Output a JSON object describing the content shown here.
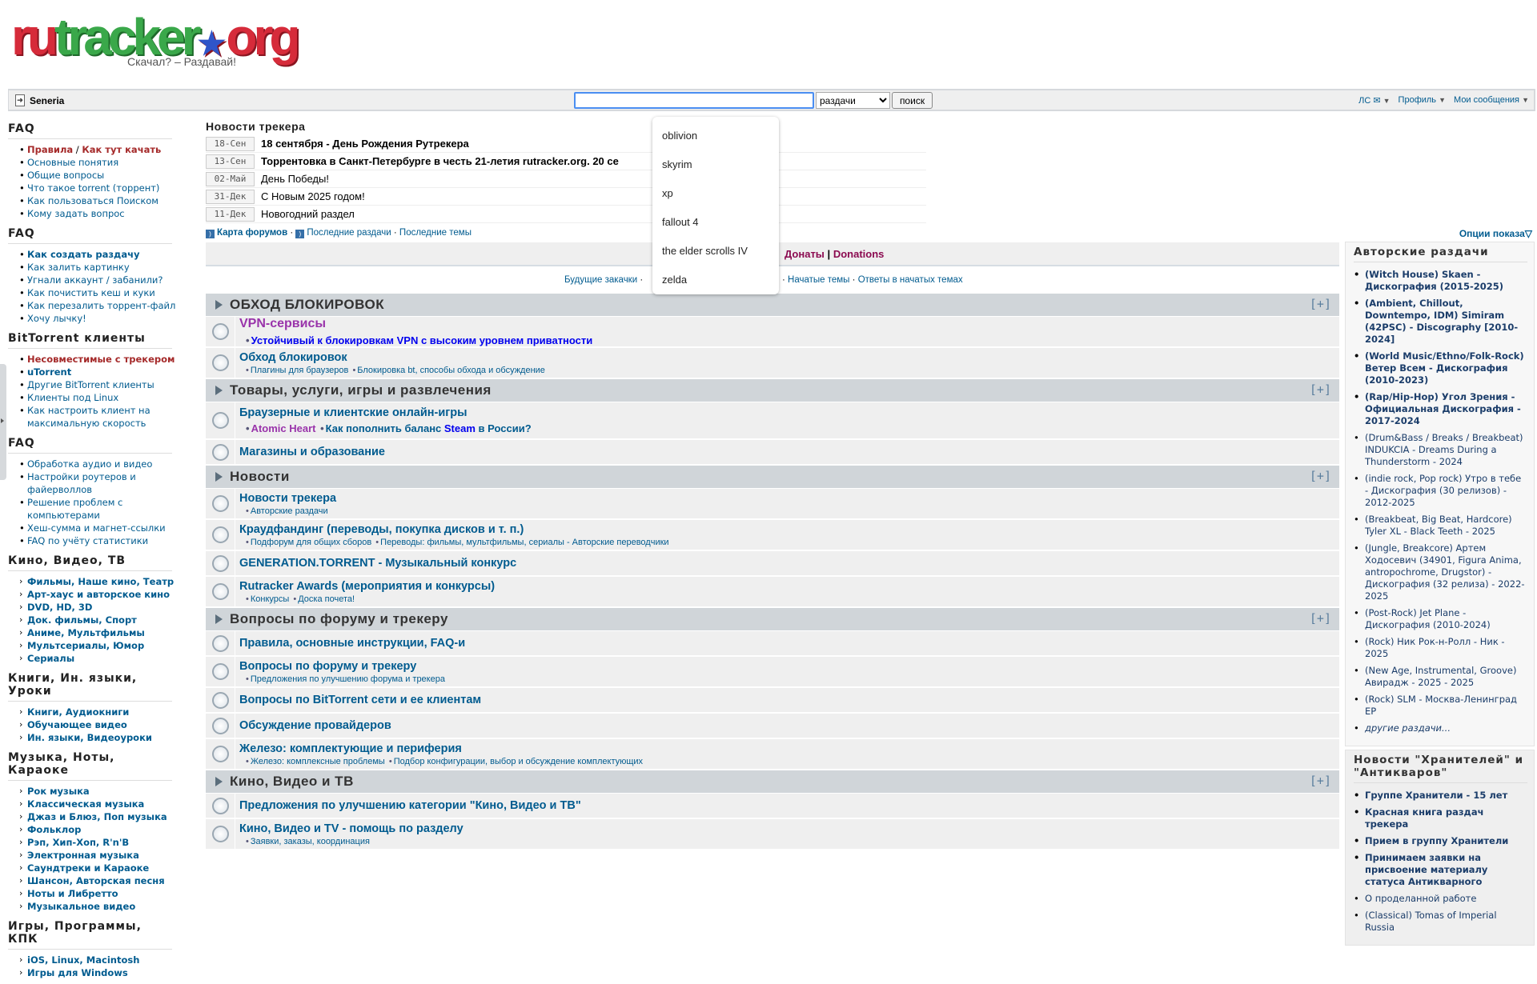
{
  "logo": {
    "text": "rutracker.org",
    "slogan": "Скачал? – Раздавай!"
  },
  "topbar": {
    "username": "Seneria",
    "search_value": "",
    "search_select": "раздачи",
    "search_button": "поиск",
    "menu": [
      {
        "label": "ЛС ✉"
      },
      {
        "label": "Профиль"
      },
      {
        "label": "Мои сообщения"
      }
    ]
  },
  "autocomplete": [
    "oblivion",
    "skyrim",
    "xp",
    "fallout 4",
    "the elder scrolls IV",
    "zelda"
  ],
  "left_sidebar": [
    {
      "title": "FAQ",
      "style": "bullet",
      "items": [
        {
          "label": "Правила",
          "red": true
        },
        {
          "label": "Основные понятия"
        },
        {
          "label": "Общие вопросы"
        },
        {
          "label": "Что такое torrent (торрент)"
        },
        {
          "label": "Как пользоваться Поиском"
        },
        {
          "label": "Кому задать вопрос"
        }
      ],
      "first_extra": "Как тут качать"
    },
    {
      "title": "FAQ",
      "style": "bullet",
      "items": [
        {
          "label": "Как создать раздачу",
          "bold": true
        },
        {
          "label": "Как залить картинку"
        },
        {
          "label": "Угнали аккаунт / забанили?"
        },
        {
          "label": "Как почистить кеш и куки"
        },
        {
          "label": "Как перезалить торрент-файл"
        },
        {
          "label": "Хочу лычку!"
        }
      ]
    },
    {
      "title": "BitTorrent клиенты",
      "style": "bullet",
      "items": [
        {
          "label": "Несовместимые с трекером",
          "red": true,
          "bold": true
        },
        {
          "label": "uTorrent",
          "bold": true
        },
        {
          "label": "Другие BitTorrent клиенты"
        },
        {
          "label": "Клиенты под Linux"
        },
        {
          "label": "Как настроить клиент на максимальную скорость"
        }
      ]
    },
    {
      "title": "FAQ",
      "style": "bullet",
      "items": [
        {
          "label": "Обработка аудио и видео"
        },
        {
          "label": "Настройки роутеров и файерволлов"
        },
        {
          "label": "Решение проблем с компьютерами"
        },
        {
          "label": "Хеш-сумма и магнет-ссылки"
        },
        {
          "label": "FAQ по учёту статистики"
        }
      ]
    },
    {
      "title": "Кино, Видео, ТВ",
      "style": "arrow",
      "items": [
        {
          "label": "Фильмы, Наше кино, Театр"
        },
        {
          "label": "Арт-хаус и авторское кино"
        },
        {
          "label": "DVD, HD, 3D"
        },
        {
          "label": "Док. фильмы, Спорт"
        },
        {
          "label": "Аниме, Мультфильмы"
        },
        {
          "label": "Мультсериалы, Юмор"
        },
        {
          "label": "Сериалы"
        }
      ]
    },
    {
      "title": "Книги, Ин. языки, Уроки",
      "style": "arrow",
      "items": [
        {
          "label": "Книги, Аудиокниги"
        },
        {
          "label": "Обучающее видео"
        },
        {
          "label": "Ин. языки, Видеоуроки"
        }
      ]
    },
    {
      "title": "Музыка, Ноты, Караоке",
      "style": "arrow",
      "items": [
        {
          "label": "Рок музыка"
        },
        {
          "label": "Классическая музыка"
        },
        {
          "label": "Джаз и Блюз, Поп музыка"
        },
        {
          "label": "Фольклор"
        },
        {
          "label": "Рэп, Хип-Хоп, R'n'B"
        },
        {
          "label": "Электронная музыка"
        },
        {
          "label": "Саундтреки и Караоке"
        },
        {
          "label": "Шансон, Авторская песня"
        },
        {
          "label": "Ноты и Либретто"
        },
        {
          "label": "Музыкальное видео"
        }
      ]
    },
    {
      "title": "Игры, Программы, КПК",
      "style": "arrow",
      "items": [
        {
          "label": "iOS, Linux, Macintosh"
        },
        {
          "label": "Игры для Windows"
        }
      ]
    }
  ],
  "news": {
    "title": "Новости трекера",
    "items": [
      {
        "date": "18-Сен",
        "text": "18 сентября - День Рождения Рутрекера",
        "bold": true
      },
      {
        "date": "13-Сен",
        "text": "Торрентовка в Санкт-Петербурге в честь 21-летия rutracker.org. 20 се",
        "bold": true
      },
      {
        "date": "02-Май",
        "text": "День Победы!",
        "bold": false
      },
      {
        "date": "31-Дек",
        "text": "С Новым 2025 годом!",
        "bold": false
      },
      {
        "date": "11-Дек",
        "text": "Новогодний раздел",
        "bold": false
      }
    ],
    "links": [
      "Карта форумов",
      "Последние раздачи",
      "Последние темы"
    ]
  },
  "display_options": "Опции показа",
  "donate": {
    "a": "Донаты",
    "sep": "|",
    "b": "Donations"
  },
  "main_links": [
    "Будущие закачки",
    "Начатые темы",
    "Ответы в начатых темах"
  ],
  "categories": [
    {
      "title": "ОБХОД БЛОКИРОВОК",
      "forums": [
        {
          "title": "VPN-сервисы",
          "vpn": true,
          "subs": [
            {
              "text": "Устойчивый к блокировкам VPN с высоким уровнем приватности",
              "color": "#0000ee"
            }
          ],
          "big": true
        },
        {
          "title": "Обход блокировок",
          "subs": [
            {
              "text": "Плагины для браузеров"
            },
            {
              "text": "Блокировка bt, способы обхода и обсуждение"
            }
          ]
        }
      ]
    },
    {
      "title": "Товары, услуги, игры и развлечения",
      "forums": [
        {
          "title": "Браузерные и клиентские онлайн-игры",
          "big": true,
          "tall": true,
          "subs": [
            {
              "text": "Atomic Heart",
              "color": "#9933aa"
            },
            {
              "text": "Как пополнить баланс ",
              "tail": "Steam",
              "tail_color": "#0000ee",
              "tail2": " в России?"
            }
          ]
        },
        {
          "title": "Магазины и образование",
          "subs": []
        }
      ]
    },
    {
      "title": "Новости",
      "forums": [
        {
          "title": "Новости трекера",
          "subs": [
            {
              "text": "Авторские раздачи"
            }
          ]
        },
        {
          "title": "Краудфандинг (переводы, покупка дисков и т. п.)",
          "subs": [
            {
              "text": "Подфорум для общих сборов"
            },
            {
              "text": "Переводы: фильмы, мультфильмы, сериалы - Авторские переводчики"
            }
          ]
        },
        {
          "title": "GENERATION.TORRENT - Музыкальный конкурс",
          "subs": []
        },
        {
          "title": "Rutracker Awards (мероприятия и конкурсы)",
          "subs": [
            {
              "text": "Конкурсы"
            },
            {
              "text": "Доска почета!"
            }
          ]
        }
      ]
    },
    {
      "title": "Вопросы по форуму и трекеру",
      "forums": [
        {
          "title": "Правила, основные инструкции, FAQ-и",
          "subs": []
        },
        {
          "title": "Вопросы по форуму и трекеру",
          "subs": [
            {
              "text": "Предложения по улучшению форума и трекера"
            }
          ]
        },
        {
          "title": "Вопросы по BitTorrent сети и ее клиентам",
          "subs": []
        },
        {
          "title": "Обсуждение провайдеров",
          "subs": []
        },
        {
          "title": "Железо: комплектующие и периферия",
          "subs": [
            {
              "text": "Железо: комплексные проблемы"
            },
            {
              "text": "Подбор конфигурации, выбор и обсуждение комплектующих"
            }
          ]
        }
      ]
    },
    {
      "title": "Кино, Видео и ТВ",
      "forums": [
        {
          "title": "Предложения по улучшению категории \"Кино, Видео и ТВ\"",
          "subs": []
        },
        {
          "title": "Кино, Видео и TV - помощь по разделу",
          "subs": [
            {
              "text": "Заявки, заказы, координация"
            }
          ]
        }
      ]
    }
  ],
  "collapse_label": "[+]",
  "right_sidebar": [
    {
      "title": "Авторские раздачи",
      "items": [
        {
          "label": "(Witch House) Skaen - Дискография (2015-2025)",
          "bold": true
        },
        {
          "label": "(Ambient, Chillout, Downtempo, IDM) Simiram (42PSC) - Discography [2010-2024]",
          "bold": true
        },
        {
          "label": "(World Music/Ethno/Folk-Rock) Ветер Всем - Дискография (2010-2023)",
          "bold": true
        },
        {
          "label": "(Rap/Hip-Hop) Угол Зрения - Официальная Дискография - 2017-2024",
          "bold": true
        },
        {
          "label": "(Drum&Bass / Breaks / Breakbeat) INDUKCIA - Dreams During a Thunderstorm - 2024"
        },
        {
          "label": "(indie rock, Pop rock) Утро в тебе - Дискография (30 релизов) - 2012-2025"
        },
        {
          "label": "(Breakbeat, Big Beat, Hardcore) Tyler XL - Black Teeth - 2025"
        },
        {
          "label": "(Jungle, Breakcore) Артем Ходосевич (34901, Figura Anima, antropochrome, Drugstor) - Дискография (32 релиза) - 2022-2025"
        },
        {
          "label": "(Post-Rock) Jet Plane - Дискография (2010-2024)"
        },
        {
          "label": "(Rock) Ник Рок-н-Ролл - Ник - 2025"
        },
        {
          "label": "(New Age, Instrumental, Groove) Авирадж - 2025 - 2025"
        },
        {
          "label": "(Rock) SLM - Москва-Ленинград EP"
        },
        {
          "label": "другие раздачи...",
          "italic": true
        }
      ]
    },
    {
      "title": "Новости \"Хранителей\" и \"Антикваров\"",
      "items": [
        {
          "label": "Группе Хранители - 15 лет",
          "bold": true
        },
        {
          "label": "Красная книга раздач трекера",
          "bold": true
        },
        {
          "label": "Прием в группу Хранители",
          "bold": true
        },
        {
          "label": "Принимаем заявки на присвоение материалу статуса Антикварного",
          "bold": true
        },
        {
          "label": "О проделанной работе"
        },
        {
          "label": "(Classical) Tomas of Imperial Russia"
        }
      ]
    }
  ]
}
